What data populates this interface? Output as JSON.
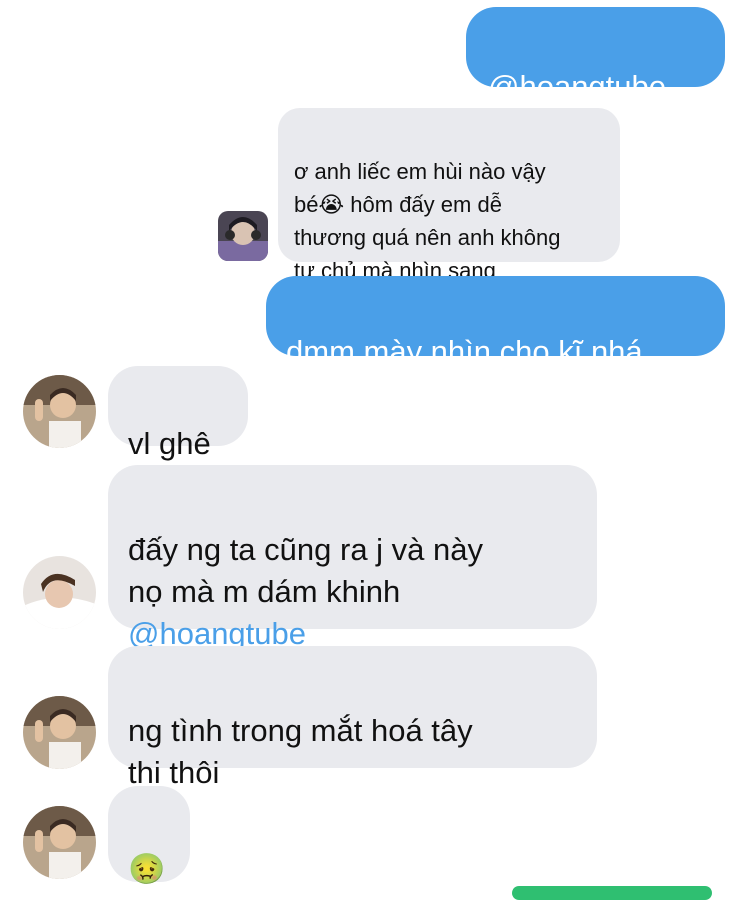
{
  "messages": {
    "m1": {
      "text": "@hoangtube"
    },
    "m2": {
      "text": "ơ anh liếc em hùi nào vậy\nbé😭 hôm đấy em dễ\nthương quá nên anh không\ntự chủ mà nhìn sang"
    },
    "m3": {
      "text": "dmm mày nhìn cho kĩ nhá"
    },
    "m4": {
      "text": "vl ghê"
    },
    "m5": {
      "text": "đấy ng ta cũng ra j và này\nnọ mà m dám khinh",
      "mention": "@hoangtube"
    },
    "m6": {
      "text": "ng tình trong mắt hoá tây\nthi thôi"
    },
    "m7": {
      "text": "🤢"
    }
  },
  "colors": {
    "outgoing_bubble": "#4a9fe8",
    "incoming_bubble": "#e9eaee",
    "mention": "#4a9fe8"
  }
}
